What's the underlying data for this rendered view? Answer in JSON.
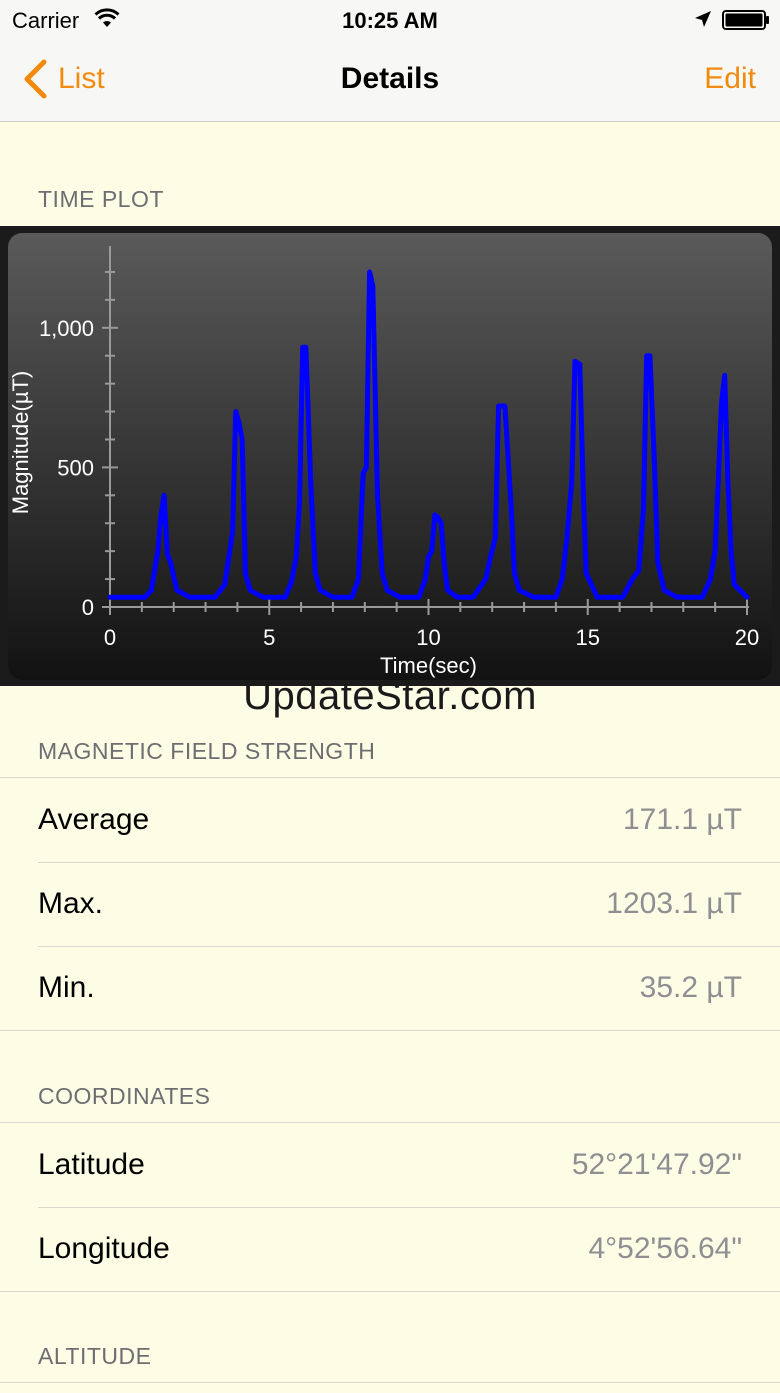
{
  "status_bar": {
    "carrier": "Carrier",
    "time": "10:25 AM",
    "icons": [
      "wifi-icon",
      "location-arrow-icon",
      "battery-icon"
    ]
  },
  "nav": {
    "back_label": "List",
    "title": "Details",
    "edit_label": "Edit",
    "accent_color": "#f28a0d"
  },
  "sections": {
    "time_plot": "TIME PLOT",
    "magnetic": "MAGNETIC FIELD STRENGTH",
    "coordinates": "COORDINATES",
    "altitude": "ALTITUDE"
  },
  "magnetic_rows": [
    {
      "label": "Average",
      "value": "171.1 µT"
    },
    {
      "label": "Max.",
      "value": "1203.1 µT"
    },
    {
      "label": "Min.",
      "value": "35.2 µT"
    }
  ],
  "coordinate_rows": [
    {
      "label": "Latitude",
      "value": "52°21'47.92\""
    },
    {
      "label": "Longitude",
      "value": "4°52'56.64\""
    }
  ],
  "watermark": "UpdateStar.com",
  "chart_data": {
    "type": "line",
    "xlabel": "Time(sec)",
    "ylabel": "Magnitude(µT)",
    "xlim": [
      0,
      20
    ],
    "ylim": [
      0,
      1250
    ],
    "x_ticks": [
      0,
      5,
      10,
      15,
      20
    ],
    "x_tick_labels": [
      "0",
      "5",
      "10",
      "15",
      "20"
    ],
    "y_ticks": [
      0,
      500,
      1000
    ],
    "y_tick_labels": [
      "0",
      "500",
      "1,000"
    ],
    "line_color": "#0000ff",
    "series": [
      {
        "x": [
          0,
          1.1,
          1.3,
          1.5,
          1.6,
          1.7,
          1.8,
          1.9,
          2.1,
          2.5,
          3.3,
          3.6,
          3.8,
          3.85,
          3.95,
          4.05,
          4.15,
          4.25,
          4.4,
          4.8,
          5.5,
          5.7,
          5.85,
          5.95,
          6.05,
          6.15,
          6.3,
          6.45,
          6.6,
          7.0,
          7.6,
          7.8,
          7.95,
          8.05,
          8.15,
          8.25,
          8.4,
          8.55,
          8.7,
          9.1,
          9.7,
          9.9,
          10.0,
          10.1,
          10.2,
          10.3,
          10.4,
          10.5,
          10.6,
          10.9,
          11.4,
          11.8,
          11.95,
          12.1,
          12.2,
          12.4,
          12.6,
          12.7,
          12.85,
          13.3,
          14.0,
          14.2,
          14.35,
          14.5,
          14.6,
          14.75,
          14.85,
          14.95,
          15.3,
          16.1,
          16.4,
          16.6,
          16.75,
          16.85,
          16.95,
          17.1,
          17.2,
          17.4,
          17.8,
          18.6,
          18.85,
          19.0,
          19.1,
          19.2,
          19.3,
          19.4,
          19.5,
          19.6,
          20.0
        ],
        "y": [
          35,
          35,
          60,
          200,
          330,
          400,
          190,
          160,
          60,
          35,
          35,
          80,
          230,
          270,
          700,
          660,
          600,
          120,
          60,
          35,
          35,
          90,
          180,
          370,
          930,
          930,
          450,
          120,
          60,
          35,
          35,
          100,
          480,
          500,
          1200,
          1150,
          400,
          120,
          60,
          35,
          35,
          100,
          180,
          200,
          330,
          320,
          300,
          150,
          60,
          35,
          35,
          100,
          180,
          250,
          720,
          720,
          350,
          120,
          60,
          35,
          35,
          100,
          250,
          450,
          880,
          870,
          450,
          120,
          35,
          35,
          100,
          130,
          350,
          900,
          900,
          500,
          160,
          60,
          35,
          35,
          100,
          200,
          450,
          730,
          830,
          450,
          200,
          80,
          35
        ]
      }
    ]
  }
}
